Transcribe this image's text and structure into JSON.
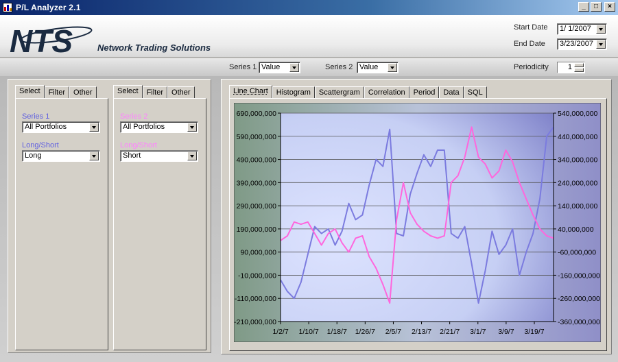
{
  "window": {
    "title": "P/L Analyzer 2.1",
    "buttons": {
      "minimize": "_",
      "maximize": "□",
      "close": "×"
    }
  },
  "header": {
    "logo_text": "NTS",
    "logo_subtitle": "Network Trading Solutions",
    "start_date_label": "Start Date",
    "start_date_value": "1/ 1/2007",
    "end_date_label": "End Date",
    "end_date_value": "3/23/2007"
  },
  "toolbar": {
    "series1_label": "Series 1",
    "series1_value": "Value",
    "series2_label": "Series 2",
    "series2_value": "Value",
    "periodicity_label": "Periodicity",
    "periodicity_value": "1"
  },
  "left_panel_1": {
    "tabs": [
      "Select",
      "Filter",
      "Other"
    ],
    "active_tab": "Select",
    "series_label": "Series 1",
    "series_label_color": "#6060e0",
    "portfolio_value": "All Portfolios",
    "longshort_label": "Long/Short",
    "longshort_label_color": "#6060e0",
    "longshort_value": "Long"
  },
  "left_panel_2": {
    "tabs": [
      "Select",
      "Filter",
      "Other"
    ],
    "active_tab": "Select",
    "series_label": "Series 2",
    "series_label_color": "#ff80ff",
    "portfolio_value": "All Portfolios",
    "longshort_label": "Long/Short",
    "longshort_label_color": "#ff80ff",
    "longshort_value": "Short"
  },
  "chart_tabs": [
    "Line Chart",
    "Histogram",
    "Scattergram",
    "Correlation",
    "Period",
    "Data",
    "SQL"
  ],
  "active_chart_tab": "Line Chart",
  "chart_data": {
    "type": "line",
    "title": "",
    "xlabel": "",
    "ylabel": "",
    "x_tick_labels": [
      "1/2/7",
      "1/10/7",
      "1/18/7",
      "1/26/7",
      "2/5/7",
      "2/13/7",
      "2/21/7",
      "3/1/7",
      "3/9/7",
      "3/19/7"
    ],
    "y_left_ticks": [
      "690,000,000",
      "590,000,000",
      "490,000,000",
      "390,000,000",
      "290,000,000",
      "190,000,000",
      "90,000,000",
      "-10,000,000",
      "-110,000,000",
      "-210,000,000"
    ],
    "y_left_range": [
      -210000000,
      690000000
    ],
    "y_right_ticks": [
      "540,000,000",
      "440,000,000",
      "340,000,000",
      "240,000,000",
      "140,000,000",
      "40,000,000",
      "-60,000,000",
      "-160,000,000",
      "-260,000,000",
      "-360,000,000"
    ],
    "y_right_range": [
      -360000000,
      540000000
    ],
    "grid": true,
    "series": [
      {
        "axis": "left",
        "color": "#7b7bdf",
        "x": [
          0,
          2,
          4,
          6,
          8,
          10,
          12,
          14,
          16,
          18,
          20,
          22,
          24,
          26,
          28,
          30,
          32,
          34,
          36,
          38,
          40,
          42,
          44,
          46,
          48,
          50,
          52,
          54,
          56,
          58,
          60,
          62,
          64,
          66,
          68,
          70,
          72,
          74,
          76,
          78,
          80
        ],
        "values": [
          -30000000,
          -80000000,
          -110000000,
          -40000000,
          80000000,
          200000000,
          170000000,
          190000000,
          120000000,
          180000000,
          300000000,
          230000000,
          250000000,
          380000000,
          490000000,
          460000000,
          620000000,
          170000000,
          160000000,
          340000000,
          430000000,
          510000000,
          460000000,
          530000000,
          530000000,
          170000000,
          150000000,
          200000000,
          40000000,
          -130000000,
          10000000,
          180000000,
          80000000,
          120000000,
          190000000,
          -10000000,
          90000000,
          170000000,
          320000000,
          590000000,
          630000000
        ]
      },
      {
        "axis": "right",
        "color": "#ff66dd",
        "x": [
          0,
          2,
          4,
          6,
          8,
          10,
          12,
          14,
          16,
          18,
          20,
          22,
          24,
          26,
          28,
          30,
          32,
          34,
          36,
          38,
          40,
          42,
          44,
          46,
          48,
          50,
          52,
          54,
          56,
          58,
          60,
          62,
          64,
          66,
          68,
          70,
          72,
          74,
          76,
          78,
          80
        ],
        "values": [
          -10000000,
          10000000,
          70000000,
          60000000,
          70000000,
          20000000,
          -30000000,
          20000000,
          40000000,
          -20000000,
          -60000000,
          0,
          10000000,
          -80000000,
          -130000000,
          -200000000,
          -280000000,
          80000000,
          240000000,
          110000000,
          60000000,
          30000000,
          10000000,
          0,
          10000000,
          240000000,
          270000000,
          350000000,
          480000000,
          350000000,
          320000000,
          260000000,
          290000000,
          380000000,
          330000000,
          240000000,
          170000000,
          100000000,
          40000000,
          10000000,
          0
        ]
      }
    ]
  }
}
